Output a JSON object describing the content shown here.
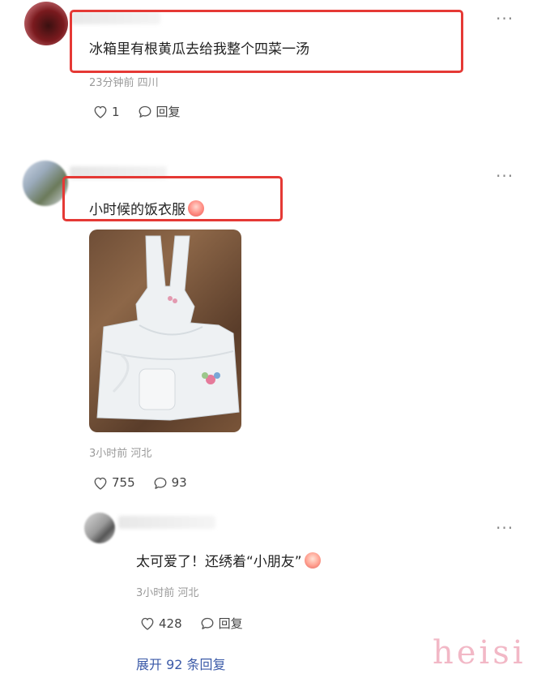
{
  "comments": [
    {
      "text": "冰箱里有根黄瓜去给我整个四菜一汤",
      "meta": "23分钟前 四川",
      "likes": "1",
      "reply_label": "回复"
    },
    {
      "text": "小时候的饭衣服",
      "meta": "3小时前 河北",
      "likes": "755",
      "replies": "93",
      "image": "apron-photo"
    }
  ],
  "reply": {
    "text": "太可爱了！还绣着“小朋友”",
    "meta": "3小时前 河北",
    "likes": "428",
    "reply_label": "回复"
  },
  "expand_label": "展开 92 条回复",
  "watermark": "heisi",
  "colors": {
    "highlight": "#e53935",
    "link": "#3b5aa8",
    "meta": "#9a9a9a"
  },
  "icons": {
    "more": "more-icon",
    "like": "heart-icon",
    "reply": "comment-bubble-icon"
  }
}
